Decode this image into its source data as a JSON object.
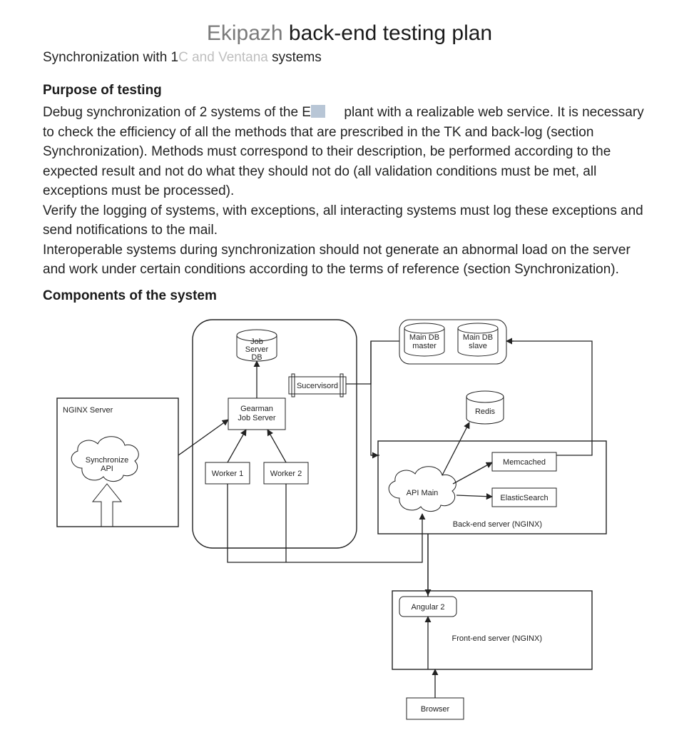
{
  "title_dim": "Ekipazh",
  "title_main": " back-end testing plan",
  "subtitle_pre": "Synchronization with 1",
  "subtitle_dim": "C and Ventana",
  "subtitle_post": " systems",
  "section_purpose": "Purpose of testing",
  "purpose_body_pre": "Debug synchronization of 2 systems of the E",
  "purpose_body_post": " plant with a realizable web service. It is necessary to check the efficiency of all the methods that are prescribed in the TK and back-log (section Synchronization). Methods must correspond to their description, be performed according to the expected result and not do what they should not do (all validation conditions must be met, all exceptions must be processed).",
  "purpose_body_p2": "Verify the logging of systems, with exceptions, all interacting systems must log these exceptions and send notifications to the mail.",
  "purpose_body_p3": "Interoperable systems during synchronization should not generate an abnormal load on the server and work under certain conditions according to the terms of reference (section Synchronization).",
  "section_components": "Components of the system",
  "diagram": {
    "nginx_server": "NGINX Server",
    "synchronize_api": "Synchronize\nAPI",
    "job_server_db_top": "Job",
    "job_server_db_mid": "Server",
    "job_server_db_bot": "DB",
    "gearman": "Gearman\nJob Server",
    "supervisord": "Sucervisord",
    "worker1": "Worker 1",
    "worker2": "Worker 2",
    "main_db_master": "Main DB\nmaster",
    "main_db_slave": "Main DB\nslave",
    "redis": "Redis",
    "memcached": "Memcached",
    "elasticsearch": "ElasticSearch",
    "api_main": "API Main",
    "backend_label": "Back-end server (NGINX)",
    "angular": "Angular 2",
    "frontend_label": "Front-end server (NGINX)",
    "browser": "Browser"
  }
}
